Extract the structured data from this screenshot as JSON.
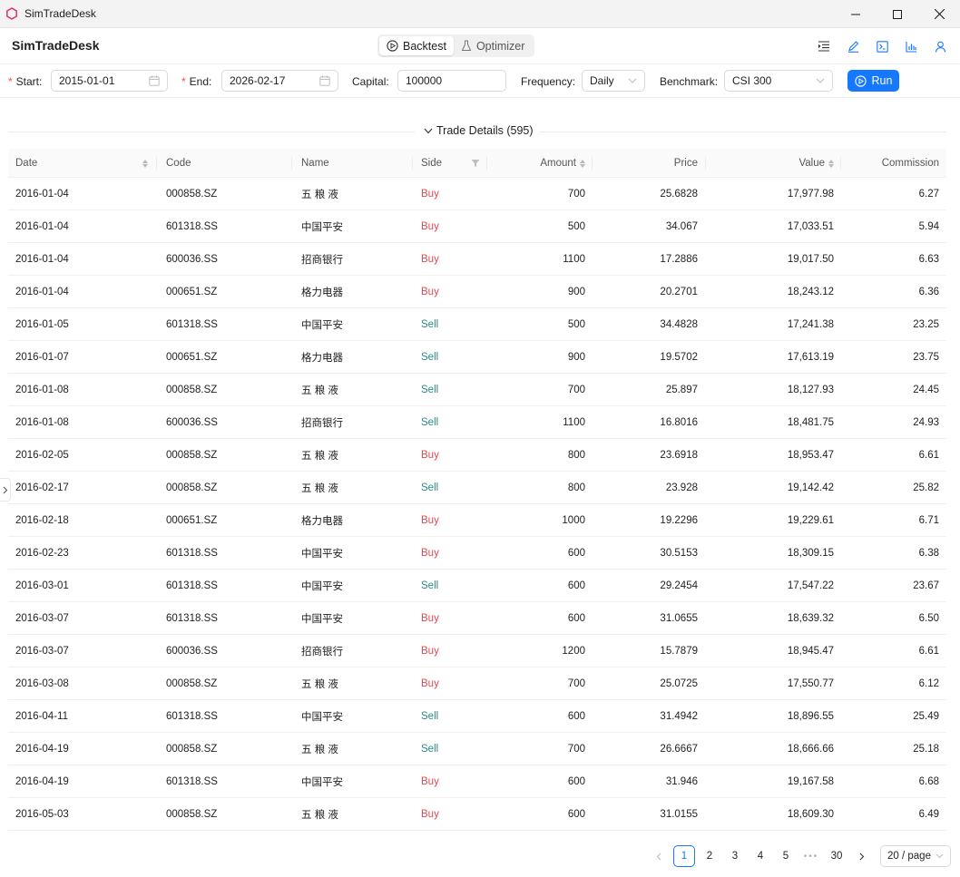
{
  "window": {
    "title": "SimTradeDesk"
  },
  "header": {
    "app_title": "SimTradeDesk",
    "modes": [
      {
        "label": "Backtest",
        "icon": "play-circle-icon",
        "active": true
      },
      {
        "label": "Optimizer",
        "icon": "flask-icon",
        "active": false
      }
    ],
    "toolbar_icons": [
      "menu-indent-icon",
      "edit-icon",
      "terminal-icon",
      "bar-chart-icon",
      "user-icon"
    ]
  },
  "controls": {
    "start": {
      "label": "Start",
      "value": "2015-01-01"
    },
    "end": {
      "label": "End",
      "value": "2026-02-17"
    },
    "capital": {
      "label": "Capital",
      "value": "100000"
    },
    "frequency": {
      "label": "Frequency",
      "value": "Daily"
    },
    "benchmark": {
      "label": "Benchmark",
      "value": "CSI 300"
    },
    "run_label": "Run",
    "colon": ":"
  },
  "section": {
    "title": "Trade Details (595)"
  },
  "table": {
    "headers": {
      "date": "Date",
      "code": "Code",
      "name": "Name",
      "side": "Side",
      "amount": "Amount",
      "price": "Price",
      "value": "Value",
      "commission": "Commission"
    },
    "rows": [
      {
        "date": "2016-01-04",
        "code": "000858.SZ",
        "name": "五 粮 液",
        "side": "Buy",
        "amount": "700",
        "price": "25.6828",
        "value": "17,977.98",
        "commission": "6.27"
      },
      {
        "date": "2016-01-04",
        "code": "601318.SS",
        "name": "中国平安",
        "side": "Buy",
        "amount": "500",
        "price": "34.067",
        "value": "17,033.51",
        "commission": "5.94"
      },
      {
        "date": "2016-01-04",
        "code": "600036.SS",
        "name": "招商银行",
        "side": "Buy",
        "amount": "1100",
        "price": "17.2886",
        "value": "19,017.50",
        "commission": "6.63"
      },
      {
        "date": "2016-01-04",
        "code": "000651.SZ",
        "name": "格力电器",
        "side": "Buy",
        "amount": "900",
        "price": "20.2701",
        "value": "18,243.12",
        "commission": "6.36"
      },
      {
        "date": "2016-01-05",
        "code": "601318.SS",
        "name": "中国平安",
        "side": "Sell",
        "amount": "500",
        "price": "34.4828",
        "value": "17,241.38",
        "commission": "23.25"
      },
      {
        "date": "2016-01-07",
        "code": "000651.SZ",
        "name": "格力电器",
        "side": "Sell",
        "amount": "900",
        "price": "19.5702",
        "value": "17,613.19",
        "commission": "23.75"
      },
      {
        "date": "2016-01-08",
        "code": "000858.SZ",
        "name": "五 粮 液",
        "side": "Sell",
        "amount": "700",
        "price": "25.897",
        "value": "18,127.93",
        "commission": "24.45"
      },
      {
        "date": "2016-01-08",
        "code": "600036.SS",
        "name": "招商银行",
        "side": "Sell",
        "amount": "1100",
        "price": "16.8016",
        "value": "18,481.75",
        "commission": "24.93"
      },
      {
        "date": "2016-02-05",
        "code": "000858.SZ",
        "name": "五 粮 液",
        "side": "Buy",
        "amount": "800",
        "price": "23.6918",
        "value": "18,953.47",
        "commission": "6.61"
      },
      {
        "date": "2016-02-17",
        "code": "000858.SZ",
        "name": "五 粮 液",
        "side": "Sell",
        "amount": "800",
        "price": "23.928",
        "value": "19,142.42",
        "commission": "25.82"
      },
      {
        "date": "2016-02-18",
        "code": "000651.SZ",
        "name": "格力电器",
        "side": "Buy",
        "amount": "1000",
        "price": "19.2296",
        "value": "19,229.61",
        "commission": "6.71"
      },
      {
        "date": "2016-02-23",
        "code": "601318.SS",
        "name": "中国平安",
        "side": "Buy",
        "amount": "600",
        "price": "30.5153",
        "value": "18,309.15",
        "commission": "6.38"
      },
      {
        "date": "2016-03-01",
        "code": "601318.SS",
        "name": "中国平安",
        "side": "Sell",
        "amount": "600",
        "price": "29.2454",
        "value": "17,547.22",
        "commission": "23.67"
      },
      {
        "date": "2016-03-07",
        "code": "601318.SS",
        "name": "中国平安",
        "side": "Buy",
        "amount": "600",
        "price": "31.0655",
        "value": "18,639.32",
        "commission": "6.50"
      },
      {
        "date": "2016-03-07",
        "code": "600036.SS",
        "name": "招商银行",
        "side": "Buy",
        "amount": "1200",
        "price": "15.7879",
        "value": "18,945.47",
        "commission": "6.61"
      },
      {
        "date": "2016-03-08",
        "code": "000858.SZ",
        "name": "五 粮 液",
        "side": "Buy",
        "amount": "700",
        "price": "25.0725",
        "value": "17,550.77",
        "commission": "6.12"
      },
      {
        "date": "2016-04-11",
        "code": "601318.SS",
        "name": "中国平安",
        "side": "Sell",
        "amount": "600",
        "price": "31.4942",
        "value": "18,896.55",
        "commission": "25.49"
      },
      {
        "date": "2016-04-19",
        "code": "000858.SZ",
        "name": "五 粮 液",
        "side": "Sell",
        "amount": "700",
        "price": "26.6667",
        "value": "18,666.66",
        "commission": "25.18"
      },
      {
        "date": "2016-04-19",
        "code": "601318.SS",
        "name": "中国平安",
        "side": "Buy",
        "amount": "600",
        "price": "31.946",
        "value": "19,167.58",
        "commission": "6.68"
      },
      {
        "date": "2016-05-03",
        "code": "000858.SZ",
        "name": "五 粮 液",
        "side": "Buy",
        "amount": "600",
        "price": "31.0155",
        "value": "18,609.30",
        "commission": "6.49"
      }
    ]
  },
  "pagination": {
    "pages": [
      "1",
      "2",
      "3",
      "4",
      "5"
    ],
    "ellipsis": "•••",
    "last_page": "30",
    "current": "1",
    "page_size": "20 / page"
  },
  "colors": {
    "accent": "#1677ff",
    "buy": "#e5484d",
    "sell": "#2b8a8a",
    "required": "#ff4d4f"
  }
}
